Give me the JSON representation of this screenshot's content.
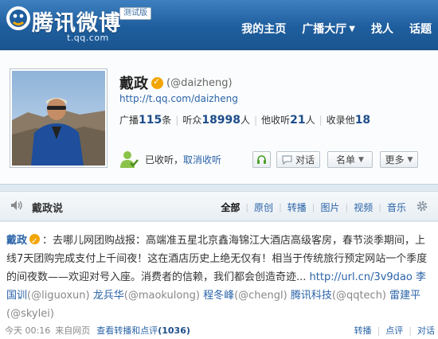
{
  "header": {
    "logo_text": "腾讯微博",
    "logo_domain": "t.qq.com",
    "beta_badge": "测试版",
    "nav": [
      {
        "label": "我的主页"
      },
      {
        "label": "广播大厅"
      },
      {
        "label": "找人"
      },
      {
        "label": "话题"
      }
    ]
  },
  "profile": {
    "name": "戴政",
    "handle": "(@daizheng)",
    "url": "http://t.qq.com/daizheng",
    "stats": [
      {
        "label": "广播",
        "value": "115",
        "unit": "条"
      },
      {
        "label": "听众",
        "value": "18998",
        "unit": "人"
      },
      {
        "label": "他收听",
        "value": "21",
        "unit": "人"
      },
      {
        "label": "收录他",
        "value": "18",
        "unit": ""
      }
    ],
    "followed_text": "已收听，",
    "unfollow_label": "取消收听",
    "chat_label": "对话",
    "list_label": "名单",
    "more_label": "更多"
  },
  "timeline": {
    "title": "戴政说",
    "tabs": [
      "全部",
      "原创",
      "转播",
      "图片",
      "视频",
      "音乐"
    ]
  },
  "post": {
    "author": "戴政",
    "text_1": "：去哪儿网团购战报：高端准五星北京鑫海锦江大酒店高级客房，春节淡季期间，上线7天团购完成支付上千间夜！这在酒店历史上绝无仅有！相当于传统旅行预定网站一个季度的间夜数——欢迎对号入座。消费者的信赖，我们都会创造奇迹... ",
    "link_url": "http://url.cn/3v9dao",
    "mention_1_name": "李国训",
    "mention_1_handle": "(@liguoxun)",
    "mention_2_name": "龙兵华",
    "mention_2_handle": "(@maokulong)",
    "mention_3_name": "程冬峰",
    "mention_3_handle": "(@chengl)",
    "mention_4_name": "腾讯科技",
    "mention_4_handle": "(@qqtech)",
    "mention_5_name": "雷建平",
    "mention_5_handle": "(@skylei)",
    "time": "今天 00:16",
    "client": "来自网页",
    "view_label": "查看转播和点评",
    "view_count": "(1036)",
    "actions": [
      "转播",
      "点评",
      "对话"
    ]
  },
  "colors": {
    "header_blue": "#1f5e9e",
    "link_blue": "#2a63a8",
    "verified_orange": "#f2a500"
  }
}
